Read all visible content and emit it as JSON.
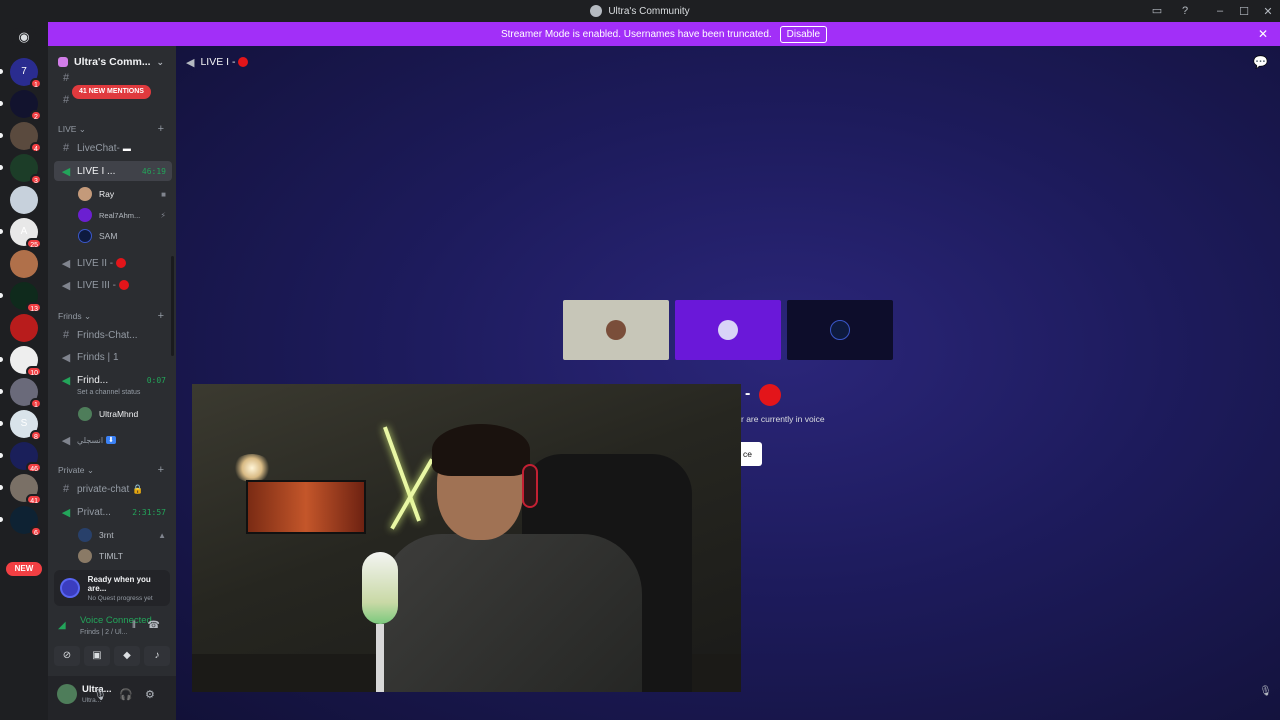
{
  "titlebar": {
    "title": "Ultra's Community"
  },
  "banner": {
    "text": "Streamer Mode is enabled. Usernames have been truncated.",
    "disable_label": "Disable"
  },
  "rail": {
    "servers": [
      {
        "label": "7",
        "badge": "1",
        "color": "#2a2c8f"
      },
      {
        "label": "",
        "badge": "2",
        "color": "#12132e"
      },
      {
        "label": "",
        "badge": "4",
        "color": "#5a4a3e"
      },
      {
        "label": "",
        "badge": "3",
        "color": "#1c3d28"
      },
      {
        "label": "",
        "badge": "",
        "color": "#c7d1dc"
      },
      {
        "label": "A",
        "badge": "25",
        "color": "#e8e8e8"
      },
      {
        "label": "",
        "badge": "",
        "color": "#b0704a"
      },
      {
        "label": "",
        "badge": "13",
        "color": "#0f2a1c"
      },
      {
        "label": "",
        "badge": "",
        "color": "#b81c1c"
      },
      {
        "label": "",
        "badge": "10",
        "color": "#eeeeee"
      },
      {
        "label": "",
        "badge": "1",
        "color": "#6a6a7a"
      },
      {
        "label": "S",
        "badge": "8",
        "color": "#d9e3ea"
      },
      {
        "label": "",
        "badge": "46",
        "color": "#1a1f5a"
      },
      {
        "label": "",
        "badge": "41",
        "color": "#7a7066"
      },
      {
        "label": "",
        "badge": "6",
        "color": "#0e2233"
      }
    ],
    "new_label": "NEW"
  },
  "sidebar": {
    "server_name": "Ultra's Comm...",
    "mentions_label": "41 NEW MENTIONS",
    "categories": {
      "live": "LIVE",
      "frinds": "Frinds",
      "private": "Private"
    },
    "channels": {
      "livechat": "LiveChat-",
      "live1": "LIVE I ...",
      "live1_timer": "46:19",
      "live2": "LIVE II -",
      "live3": "LIVE III -",
      "frinds_chat": "Frinds-Chat...",
      "frinds1": "Frinds | 1",
      "frinds_voice": "Frind...",
      "frinds_voice_timer": "0:07",
      "set_status": "Set a channel status",
      "arabic": "انسجلي",
      "private_chat": "private-chat",
      "private_voice": "Privat...",
      "private_voice_timer": "2:31:57"
    },
    "voice_users": {
      "ray": "Ray",
      "real": "Real7Ahm...",
      "sam": "SAM",
      "ultra": "UltraMhnd",
      "rnt": "3rnt",
      "timlt": "TIMLT"
    },
    "quest": {
      "title": "Ready when you are...",
      "subtitle": "No Quest progress yet"
    },
    "voice": {
      "title": "Voice Connected",
      "subtitle": "Frinds | 2 / Ul..."
    },
    "user": {
      "name": "Ultra...",
      "status": "Ultra..."
    }
  },
  "main": {
    "channel_title": "LIVE I -",
    "behind": {
      "title": "-",
      "subtitle": "r are currently in voice",
      "button": "ce"
    }
  },
  "colors": {
    "accent": "#5865f2",
    "banner": "#a22ff8",
    "live_red": "#e3151a",
    "voice_green": "#23a55a"
  }
}
